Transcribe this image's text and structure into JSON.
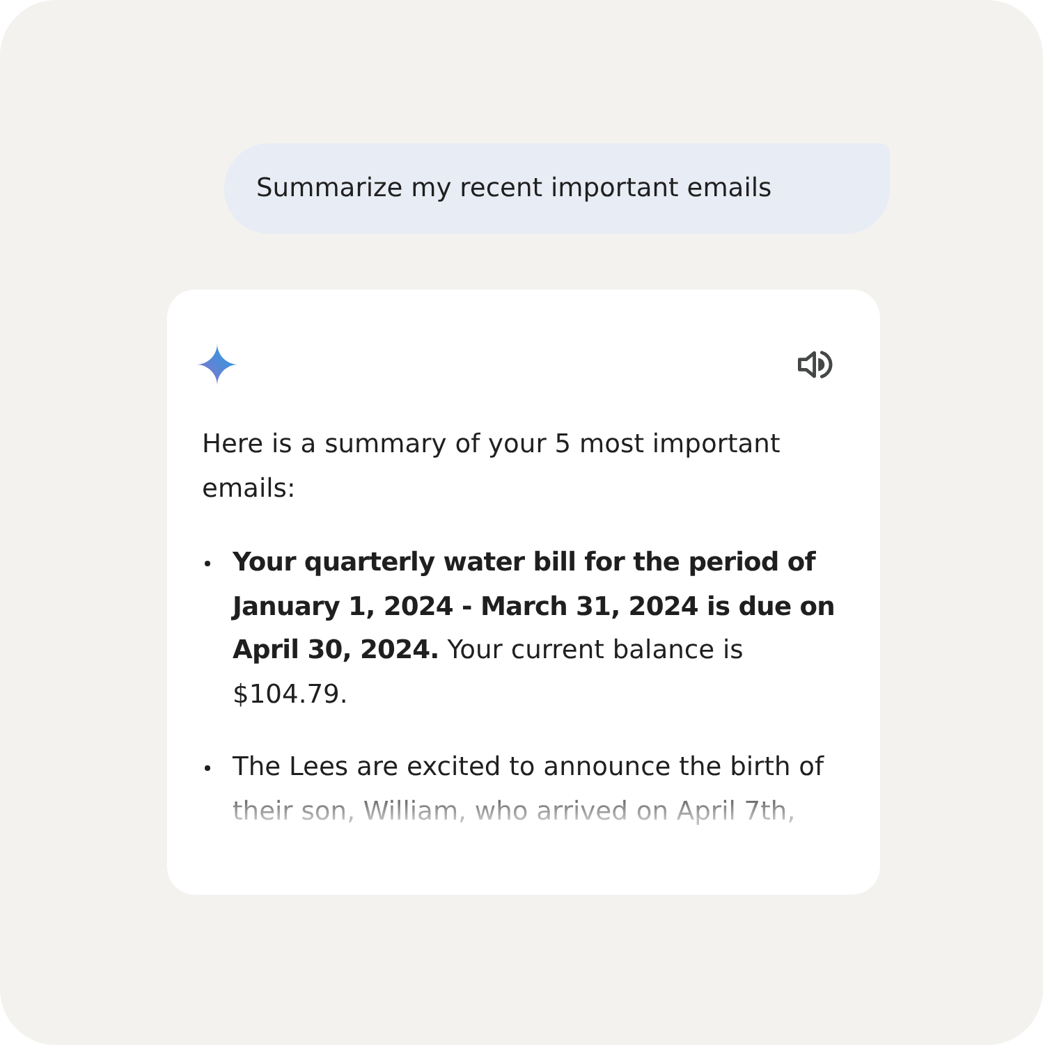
{
  "user_message": {
    "text": "Summarize my recent important emails"
  },
  "response": {
    "faded": true,
    "intro": "Here is a summary of your 5 most important emails:",
    "bullets": [
      {
        "text": "**Your quarterly water bill for the period of January 1, 2024 - March 31, 2024 is due on April 30, 2024.** Your current balance is $104.79."
      },
      {
        "text": "The Lees are excited to announce the birth of their son, William, who arrived on April 7th,"
      }
    ]
  }
}
